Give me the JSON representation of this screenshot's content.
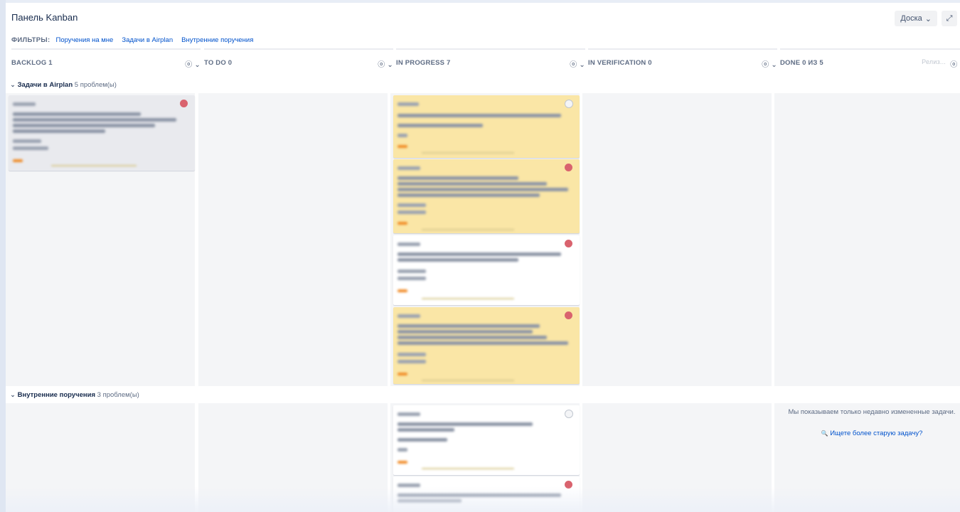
{
  "header": {
    "title": "Панель Kanban",
    "board_button": "Доска",
    "board_chevron": "⌄",
    "expand_icon": "⤢"
  },
  "filters": {
    "label": "ФИЛЬТРЫ:",
    "items": [
      "Поручения на мне",
      "Задачи в Airplan",
      "Внутренние поручения"
    ]
  },
  "columns": [
    {
      "name": "BACKLOG 1"
    },
    {
      "name": "TO DO 0"
    },
    {
      "name": "IN PROGRESS 7"
    },
    {
      "name": "IN VERIFICATION 0"
    },
    {
      "name": "DONE 0 ИЗ 5",
      "release": "Релиз..."
    }
  ],
  "column_menu_icon": "ⓞ ⌄",
  "swimlanes": [
    {
      "name": "Задачи в Airplan",
      "count": "5 проблем(ы)",
      "toggle": "⌄"
    },
    {
      "name": "Внутренние поручения",
      "count": "3 проблем(ы)",
      "toggle": "⌄"
    }
  ],
  "done_column": {
    "note": "Мы показываем только недавно измененные задачи.",
    "link": "Ищете более старую задачу?",
    "link_icon": "🔍"
  },
  "colors": {
    "accent": "#0052cc",
    "card_yellow": "#fae6a6",
    "column_bg": "#f4f5f7",
    "priority_red": "#d9636e"
  }
}
